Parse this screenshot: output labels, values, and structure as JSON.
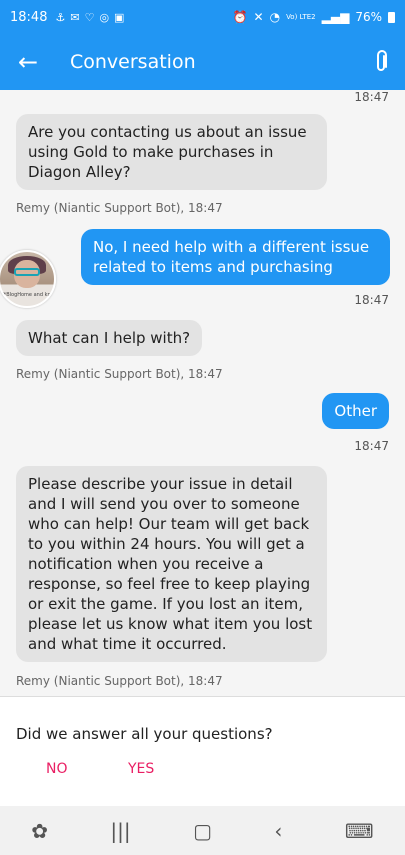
{
  "status_bar": {
    "time": "18:48",
    "network": "Vo) LTE2",
    "battery": "76%"
  },
  "app_bar": {
    "title": "Conversation",
    "back_icon": "arrow-left-icon",
    "attach_icon": "paperclip-icon"
  },
  "messages": [
    {
      "type": "timestamp",
      "text": "18:47"
    },
    {
      "type": "incoming",
      "text": "Are you contacting us about an issue using Gold to make purchases in Diagon Alley?",
      "meta": "Remy (Niantic Support Bot), 18:47"
    },
    {
      "type": "outgoing",
      "text": "No, I need help with a different issue related to items and purchasing",
      "meta": "18:47"
    },
    {
      "type": "incoming",
      "text": "What can I help with?",
      "meta": "Remy (Niantic Support Bot), 18:47"
    },
    {
      "type": "outgoing",
      "text": "Other",
      "meta": "18:47"
    },
    {
      "type": "incoming",
      "text": "Please describe your issue in detail and I will send you over to someone who can help! Our team will get back to you within 24 hours. You will get a notification when you receive a response, so feel free to keep playing or exit the game. If you lost an item, please let us know what item you lost and what time it occurred.",
      "meta": "Remy (Niantic Support Bot), 18:47"
    }
  ],
  "avatar": {
    "caption": "#BlogHome and knit"
  },
  "feedback": {
    "question": "Did we answer all your questions?",
    "no_label": "NO",
    "yes_label": "YES"
  },
  "colors": {
    "primary": "#2196f3",
    "incoming_bubble": "#e3e3e3",
    "feedback_accent": "#e91e63"
  }
}
